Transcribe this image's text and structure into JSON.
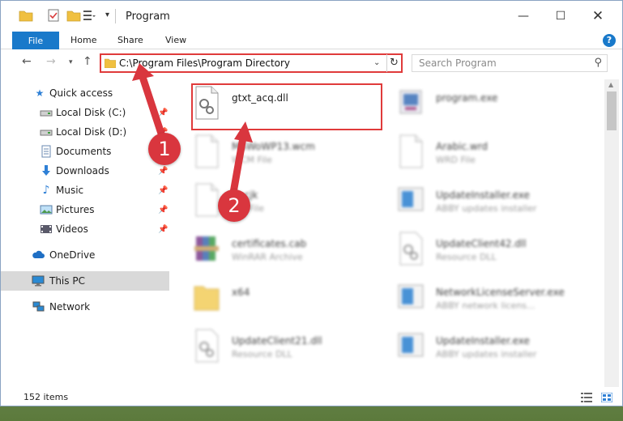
{
  "window": {
    "title": "Program",
    "minimize": "—",
    "maximize": "☐",
    "close": "✕"
  },
  "ribbon": {
    "file": "File",
    "home": "Home",
    "share": "Share",
    "view": "View",
    "help": "?"
  },
  "address": {
    "path": "C:\\Program Files\\Program Directory",
    "search_placeholder": "Search Program"
  },
  "sidebar": {
    "items": [
      {
        "label": "Quick access",
        "icon": "star-icon",
        "pinned": false
      },
      {
        "label": "Local Disk (C:)",
        "icon": "drive-icon",
        "pinned": true
      },
      {
        "label": "Local Disk (D:)",
        "icon": "drive-icon",
        "pinned": true
      },
      {
        "label": "Documents",
        "icon": "documents-icon",
        "pinned": true
      },
      {
        "label": "Downloads",
        "icon": "download-icon",
        "pinned": true
      },
      {
        "label": "Music",
        "icon": "music-icon",
        "pinned": true
      },
      {
        "label": "Pictures",
        "icon": "pictures-icon",
        "pinned": true
      },
      {
        "label": "Videos",
        "icon": "videos-icon",
        "pinned": true
      },
      {
        "label": "OneDrive",
        "icon": "cloud-icon",
        "pinned": false
      },
      {
        "label": "This PC",
        "icon": "computer-icon",
        "pinned": false,
        "selected": true
      },
      {
        "label": "Network",
        "icon": "network-icon",
        "pinned": false
      }
    ]
  },
  "files": [
    {
      "name": "gtxt_acq.dll",
      "type": "",
      "icon": "dll-file-icon",
      "highlighted": true
    },
    {
      "name": "program.exe",
      "type": "",
      "icon": "exe-file-icon"
    },
    {
      "name": "MSWoWP13.wcm",
      "type": "WCM File",
      "icon": "generic-file-icon"
    },
    {
      "name": "Arabic.wrd",
      "type": "WRD File",
      "icon": "generic-file-icon"
    },
    {
      "name": "m.cjk",
      "type": "CJK File",
      "icon": "generic-file-icon"
    },
    {
      "name": "UpdateInstaller.exe",
      "type": "ABBY updates installer",
      "icon": "installer-icon"
    },
    {
      "name": "certificates.cab",
      "type": "WinRAR Archive",
      "icon": "winrar-icon"
    },
    {
      "name": "UpdateClient42.dll",
      "type": "Resource DLL",
      "icon": "dll-file-icon"
    },
    {
      "name": "x64",
      "type": "",
      "icon": "folder-icon"
    },
    {
      "name": "NetworkLicenseServer.exe",
      "type": "ABBY network licens...",
      "icon": "installer-icon"
    },
    {
      "name": "UpdateClient21.dll",
      "type": "Resource DLL",
      "icon": "dll-file-icon"
    },
    {
      "name": "UpdateInstaller.exe",
      "type": "ABBY updates installer",
      "icon": "installer-icon"
    }
  ],
  "status": {
    "items": "152 items"
  },
  "annotations": {
    "step1": "1",
    "step2": "2"
  },
  "colors": {
    "accent": "#1979ca",
    "highlight": "#e03b3b",
    "callout": "#d9363e"
  }
}
